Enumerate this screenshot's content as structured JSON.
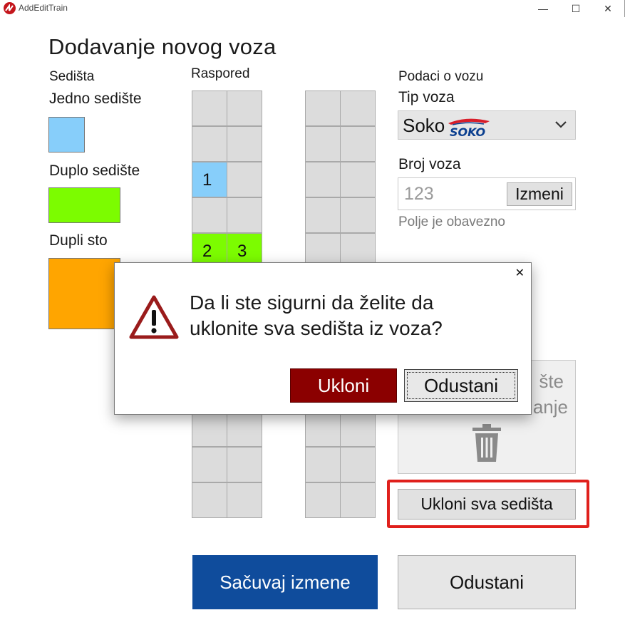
{
  "window": {
    "title": "AddEditTrain",
    "minimize_glyph": "—",
    "maximize_glyph": "☐",
    "close_glyph": "✕"
  },
  "page_title": "Dodavanje novog voza",
  "seats_panel": {
    "heading": "Sedišta",
    "types": [
      {
        "label": "Jedno sedište",
        "color": "#87cefa"
      },
      {
        "label": "Duplo sedište",
        "color": "#7cfc00"
      },
      {
        "label": "Dupli sto",
        "color": "#ffa500"
      }
    ]
  },
  "layout": {
    "heading": "Raspored",
    "seat_numbers": [
      "1",
      "2",
      "3"
    ]
  },
  "train_info": {
    "heading": "Podaci o vozu",
    "type_label": "Tip voza",
    "type_value": "Soko",
    "type_logo_text": "SOKO",
    "number_label": "Broj voza",
    "number_placeholder": "123",
    "edit_button": "Izmeni",
    "required_hint": "Polje je obavezno",
    "drop_zone_line1": "šte",
    "drop_zone_line2": "anje",
    "trash_icon": "trash-icon"
  },
  "buttons": {
    "remove_all": "Ukloni sva sedišta",
    "save": "Sačuvaj izmene",
    "cancel": "Odustani"
  },
  "dialog": {
    "close_glyph": "✕",
    "message": "Da li ste sigurni da želite da uklonite sva sedišta iz voza?",
    "confirm": "Ukloni",
    "cancel": "Odustani",
    "icon": "warning-icon"
  },
  "colors": {
    "primary": "#0f4c9c",
    "danger": "#8b0000",
    "highlight": "#e0201c"
  }
}
